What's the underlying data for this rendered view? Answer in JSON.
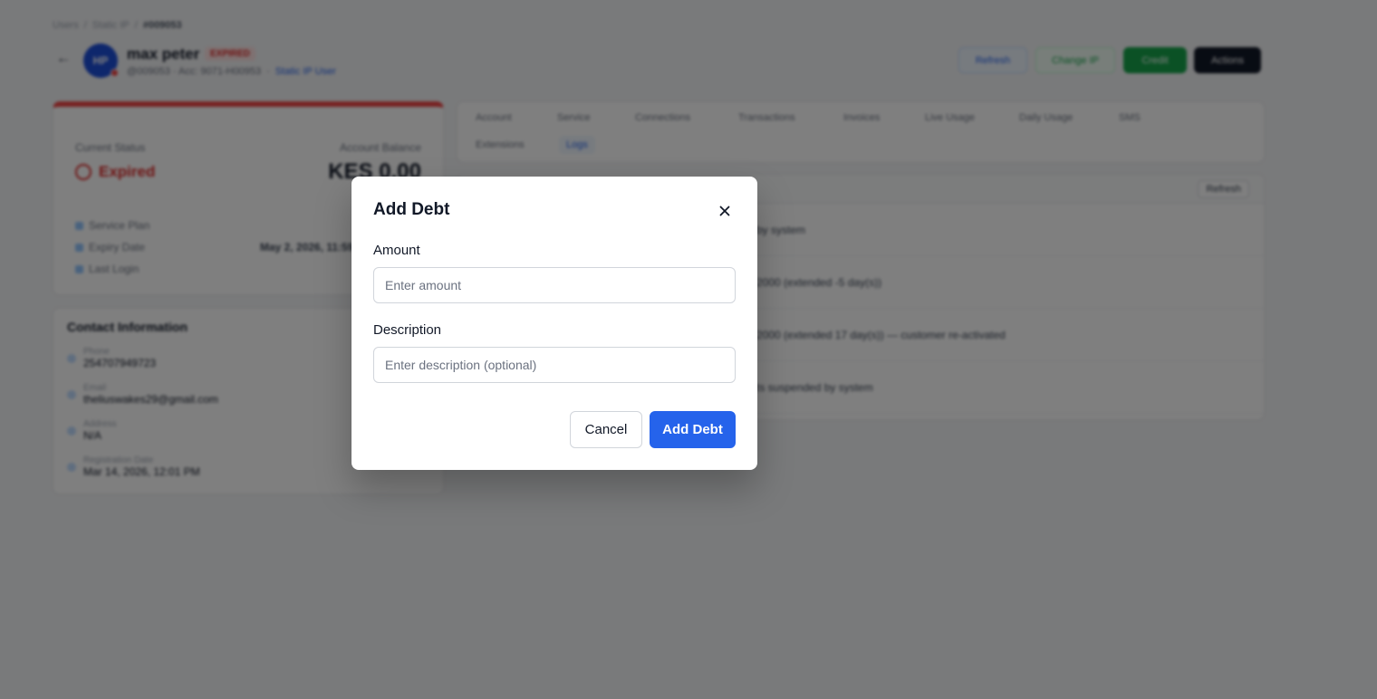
{
  "background": {
    "breadcrumbs": [
      "Users",
      "Static IP",
      "#009053"
    ],
    "user": {
      "avatar_initials": "HP",
      "name": "max peter",
      "status_badge": "EXPIRED",
      "account": "@009053 · Acc: 9071-H00953",
      "static_ip_label": "Static IP User"
    },
    "header_buttons": {
      "refresh": "Refresh",
      "change_ip": "Change IP",
      "credit": "Credit",
      "actions": "Actions"
    },
    "status_card": {
      "current_status_label": "Current Status",
      "current_status_value": "Expired",
      "balance_label": "Account Balance",
      "balance_value": "KES 0.00",
      "service_plan_label": "Service Plan",
      "expiry_label": "Expiry Date",
      "expiry_value": "May 2, 2026, 11:59",
      "last_login_label": "Last Login"
    },
    "contact": {
      "title": "Contact Information",
      "rows": [
        {
          "key": "Phone",
          "value": "254707949723"
        },
        {
          "key": "Email",
          "value": "theliuswakes29@gmail.com"
        },
        {
          "key": "Address",
          "value": "N/A"
        },
        {
          "key": "Registration Date",
          "value": "Mar 14, 2026, 12:01 PM"
        }
      ]
    },
    "tabs": [
      "Account",
      "Service",
      "Connections",
      "Transactions",
      "Invoices",
      "Live Usage",
      "Daily Usage",
      "SMS",
      "Extensions",
      "Logs"
    ],
    "logs": {
      "refresh_label": "Refresh",
      "rows": [
        "by system",
        "2000 (extended -5 day(s))",
        "2000 (extended 17 day(s)) — customer re-activated",
        "ts suspended by system"
      ]
    }
  },
  "modal": {
    "title": "Add Debt",
    "close_icon": "close-icon",
    "amount_label": "Amount",
    "amount_placeholder": "Enter amount",
    "amount_value": "",
    "description_label": "Description",
    "description_placeholder": "Enter description (optional)",
    "description_value": "",
    "cancel_label": "Cancel",
    "submit_label": "Add Debt",
    "colors": {
      "primary": "#2563eb",
      "overlay": "rgba(0,0,0,0.5)"
    }
  }
}
